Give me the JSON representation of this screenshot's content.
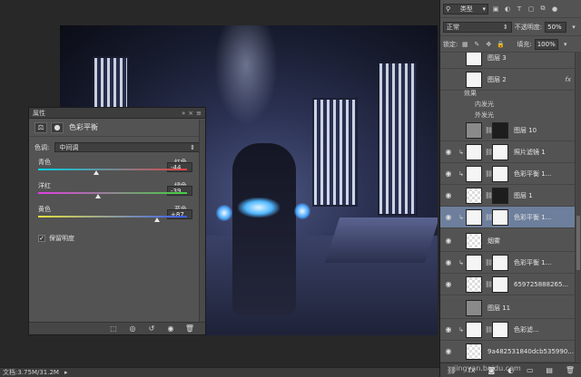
{
  "canvas": {
    "description_color": "#2b3152"
  },
  "properties": {
    "title": "属性",
    "header_label": "色彩平衡",
    "tone_label": "色调:",
    "tone_value": "中间调",
    "sliders": [
      {
        "left": "青色",
        "right": "红色",
        "value": "-44",
        "position": 0.39,
        "track": "cyan-red"
      },
      {
        "left": "洋红",
        "right": "绿色",
        "value": "-39",
        "position": 0.4,
        "track": "magenta-green"
      },
      {
        "left": "黄色",
        "right": "蓝色",
        "value": "+87",
        "position": 0.8,
        "track": "yellow-blue"
      }
    ],
    "preserve_luminosity": "保留明度",
    "preserve_checked": true
  },
  "status": {
    "doc_info": "文档:3.75M/31.2M"
  },
  "layers": {
    "kind_label": "类型",
    "blend_mode": "正常",
    "opacity_label": "不透明度:",
    "opacity_value": "50%",
    "lock_label": "锁定:",
    "fill_label": "填充:",
    "fill_value": "100%",
    "items": [
      {
        "name": "图层 3",
        "thumb": "white",
        "visible": false,
        "adj": false,
        "mask": false
      },
      {
        "name": "图层 2",
        "thumb": "white",
        "visible": false,
        "adj": false,
        "mask": false,
        "fx": "fx"
      },
      {
        "name": "图层 10",
        "thumb": "gray",
        "visible": false,
        "adj": false,
        "mask": true
      },
      {
        "name": "照片滤镜 1",
        "thumb": "white",
        "visible": true,
        "adj": true,
        "mask": true
      },
      {
        "name": "色彩平衡 1...",
        "thumb": "white",
        "visible": true,
        "adj": true,
        "mask": true
      },
      {
        "name": "图层 1",
        "thumb": "checker",
        "visible": true,
        "adj": false,
        "mask": true
      },
      {
        "name": "色彩平衡 1...",
        "thumb": "white",
        "visible": true,
        "adj": true,
        "mask": true,
        "selected": true
      },
      {
        "name": "烟雾",
        "thumb": "checker",
        "visible": true,
        "adj": false,
        "mask": false
      },
      {
        "name": "色彩平衡 1...",
        "thumb": "white",
        "visible": true,
        "adj": true,
        "mask": true
      },
      {
        "name": "659725888265...",
        "thumb": "checker",
        "visible": true,
        "adj": false,
        "mask": true
      },
      {
        "name": "图层 11",
        "thumb": "gray",
        "visible": false,
        "adj": false,
        "mask": false
      },
      {
        "name": "色彩滤...",
        "thumb": "white",
        "visible": true,
        "adj": true,
        "mask": true
      },
      {
        "name": "9a482531840dcb535990...",
        "thumb": "checker",
        "visible": true,
        "adj": false,
        "mask": false
      }
    ],
    "effects": {
      "title": "效果",
      "inner": "内发光",
      "outer": "外发光"
    }
  },
  "watermark": "jingyan.baidu.com"
}
